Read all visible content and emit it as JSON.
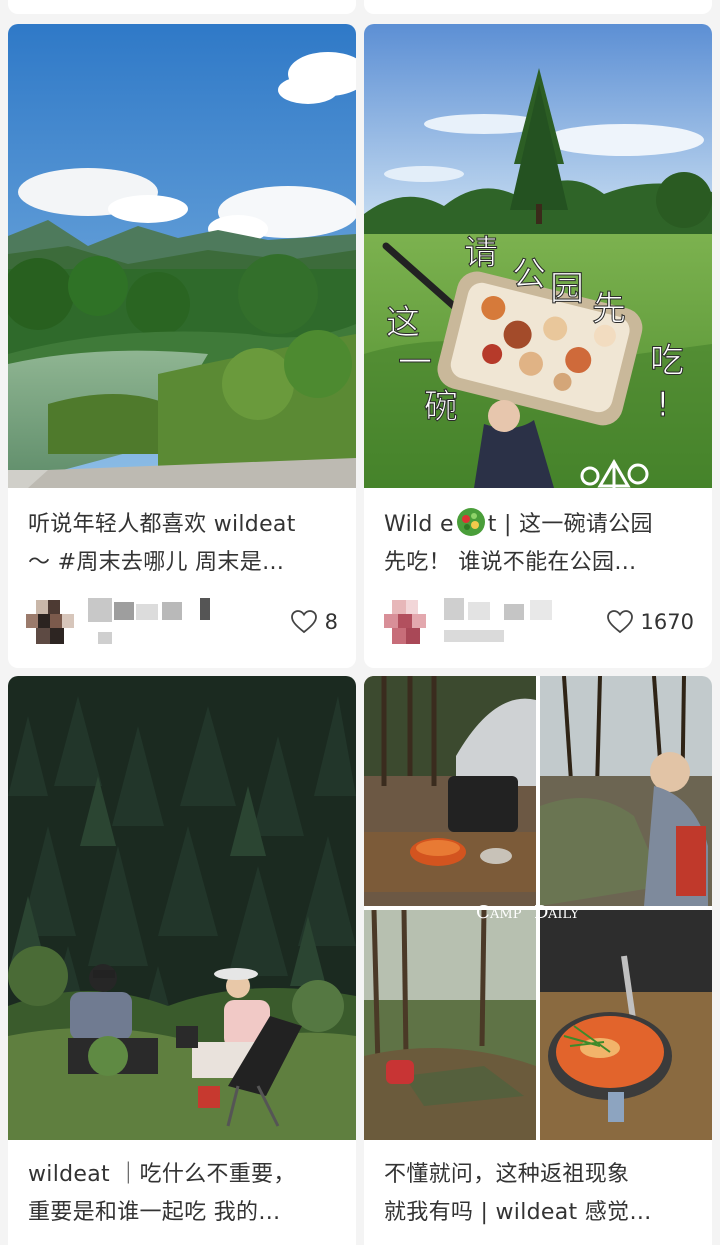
{
  "feed": {
    "cards": [
      {
        "title_line1": "听说年轻人都喜欢 wildeat",
        "title_line2": "～ #周末去哪儿  周末是…",
        "likes": "8",
        "cover": "mountain-lake-photo"
      },
      {
        "title_line1_a": "Wild e",
        "title_line1_b": "t | 这一碗请公园",
        "title_line2": "先吃！ 谁说不能在公园…",
        "likes": "1670",
        "cover": "park-lunch-bowl-photo",
        "overlay_text": [
          "请",
          "公",
          "园",
          "先",
          "吃",
          "！",
          "这",
          "一",
          "碗"
        ]
      },
      {
        "title_line1": "wildeat ｜吃什么不重要，",
        "title_line2": "重要是和谁一起吃 我的…",
        "cover": "forest-picnic-couple-photo"
      },
      {
        "title_line1": "不懂就问，这种返祖现象",
        "title_line2": "就我有吗 | wildeat 感觉…",
        "cover": "camping-collage-photo",
        "overlay_text": "CAMP DAILY"
      }
    ]
  },
  "colors": {
    "background": "#f4f4f4",
    "card": "#ffffff",
    "text": "#333333",
    "heart_outline": "#444444"
  },
  "icons": {
    "like": "heart-outline-icon"
  }
}
